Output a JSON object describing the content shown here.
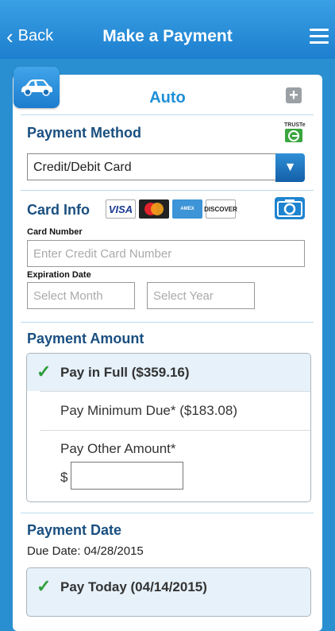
{
  "nav": {
    "back_label": "Back",
    "title": "Make a Payment"
  },
  "account": {
    "label": "Auto"
  },
  "payment_method": {
    "heading": "Payment Method",
    "truste_label": "TRUSTe",
    "selected": "Credit/Debit Card"
  },
  "card_info": {
    "heading": "Card Info",
    "brands": [
      "VISA",
      "MasterCard",
      "AMERICAN EXPRESS",
      "DISCOVER"
    ],
    "card_number_label": "Card Number",
    "card_number_placeholder": "Enter Credit Card Number",
    "expiration_label": "Expiration Date",
    "month_placeholder": "Select Month",
    "year_placeholder": "Select Year"
  },
  "payment_amount": {
    "heading": "Payment Amount",
    "options": [
      {
        "label": "Pay in Full ($359.16)",
        "selected": true
      },
      {
        "label": "Pay Minimum Due* ($183.08)",
        "selected": false
      },
      {
        "label": "Pay Other Amount*",
        "selected": false
      }
    ],
    "currency_symbol": "$",
    "other_amount_value": ""
  },
  "payment_date": {
    "heading": "Payment Date",
    "due_date": "Due Date: 04/28/2015",
    "options": [
      {
        "label": "Pay Today (04/14/2015)",
        "selected": true
      }
    ]
  },
  "colors": {
    "brand_blue": "#1f84d0",
    "heading_navy": "#1a4f80",
    "check_green": "#2f9e3a",
    "selected_bg": "#e6f1fa"
  }
}
